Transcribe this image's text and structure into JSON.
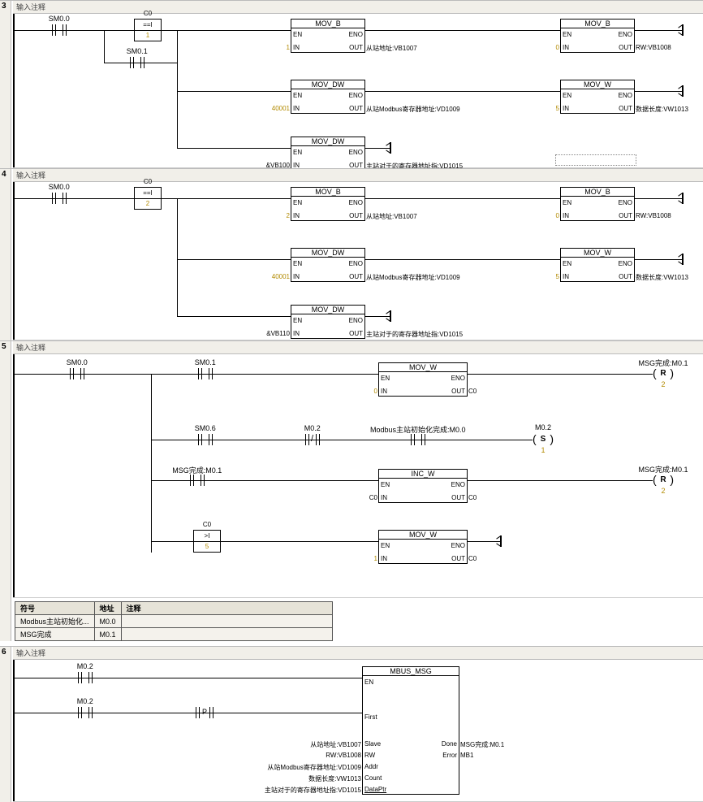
{
  "common": {
    "comment_placeholder": "输入注释"
  },
  "pins": {
    "en": "EN",
    "eno": "ENO",
    "in": "IN",
    "out": "OUT",
    "first": "First",
    "slave": "Slave",
    "rw": "RW",
    "addr": "Addr",
    "count": "Count",
    "dataptr": "DataPtr",
    "done": "Done",
    "error": "Error"
  },
  "labels": {
    "sm00": "SM0.0",
    "sm01": "SM0.1",
    "sm06": "SM0.6",
    "m02": "M0.2",
    "c0": "C0",
    "msg_done": "MSG完成:M0.1",
    "modbus_init": "Modbus主站初始化完成:M0.0"
  },
  "fblocks": {
    "mov_b": "MOV_B",
    "mov_w": "MOV_W",
    "mov_dw": "MOV_DW",
    "inc_w": "INC_W",
    "mbus": "MBUS_MSG"
  },
  "net3": {
    "num": "3",
    "cmp": "==I",
    "cmp_val": "1",
    "b1_in": "1",
    "b1_out": "从站地址:VB1007",
    "b2_in": "0",
    "b2_out": "RW:VB1008",
    "dw1_in": "40001",
    "dw1_out": "从站Modbus寄存器地址:VD1009",
    "w2_in": "5",
    "w2_out": "数据长度:VW1013",
    "dw2_in": "&VB100",
    "dw2_out": "主站对于的寄存器地址指:VD1015"
  },
  "net4": {
    "num": "4",
    "cmp": "==I",
    "cmp_val": "2",
    "b1_in": "2",
    "b1_out": "从站地址:VB1007",
    "b2_in": "0",
    "b2_out": "RW:VB1008",
    "dw1_in": "40001",
    "dw1_out": "从站Modbus寄存器地址:VD1009",
    "w2_in": "5",
    "w2_out": "数据长度:VW1013",
    "dw2_in": "&VB110",
    "dw2_out": "主站对于的寄存器地址指:VD1015"
  },
  "net5": {
    "num": "5",
    "mov_w1_in": "0",
    "mov_w1_out": "C0",
    "coil_r_lbl": "MSG完成:M0.1",
    "coil_r_n": "2",
    "coil_s_n": "1",
    "inc_in": "C0",
    "inc_out": "C0",
    "cmp": ">I",
    "cmp_val": "5",
    "mov_w2_in": "1",
    "mov_w2_out": "C0",
    "sym": {
      "h1": "符号",
      "h2": "地址",
      "h3": "注释",
      "r1c1": "Modbus主站初始化...",
      "r1c2": "M0.0",
      "r2c1": "MSG完成",
      "r2c2": "M0.1"
    }
  },
  "net6": {
    "num": "6",
    "p": "P",
    "in_slave": "从站地址:VB1007",
    "in_rw": "RW:VB1008",
    "in_addr": "从站Modbus寄存器地址:VD1009",
    "in_count": "数据长度:VW1013",
    "in_ptr": "主站对于的寄存器地址指:VD1015",
    "out_done": "MSG完成:M0.1",
    "out_err": "MB1"
  }
}
